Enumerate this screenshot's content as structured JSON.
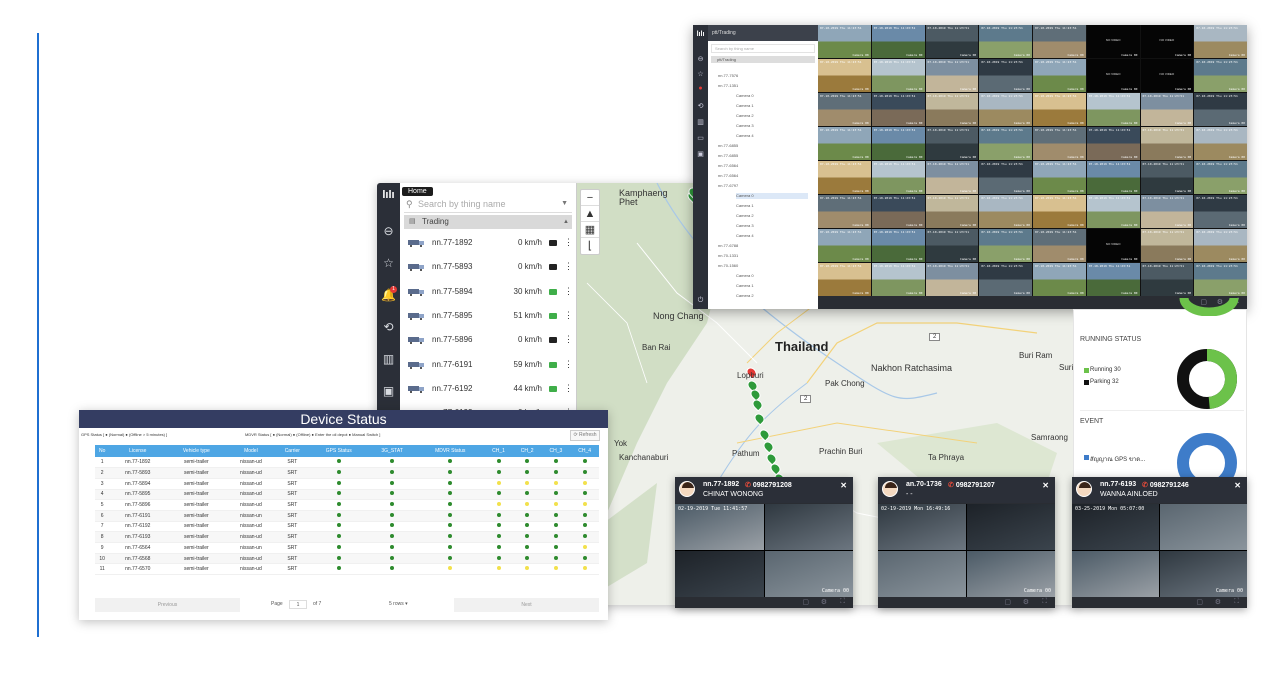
{
  "map": {
    "home_tooltip": "Home",
    "search_placeholder": "Search by thing name",
    "group_name": "Trading",
    "zoom_in": "+",
    "zoom_out": "−",
    "labels": {
      "country": "Thailand",
      "kamphaeng": "Kamphaeng\nPhet",
      "nong_chang": "Nong Chang",
      "ban_rai": "Ban Rai",
      "lopburi": "Lopburi",
      "pak_chong": "Pak Chong",
      "nakhon": "Nakhon Ratchasima",
      "buri_ram": "Buri Ram",
      "surin": "Surin",
      "kanchanaburi": "Kanchanaburi",
      "pathum": "Pathum",
      "prachin": "Prachin Buri",
      "ta_phraya": "Ta Phraya",
      "samraong": "Samraong",
      "yok": "Yok",
      "road_2": "2",
      "road_2b": "2"
    },
    "vehicles": [
      {
        "plate": "nn.77-1892",
        "speed": "0 km/h",
        "status_color": "#222222"
      },
      {
        "plate": "nn.77-5893",
        "speed": "0 km/h",
        "status_color": "#222222"
      },
      {
        "plate": "nn.77-5894",
        "speed": "30 km/h",
        "status_color": "#3fae49"
      },
      {
        "plate": "nn.77-5895",
        "speed": "51 km/h",
        "status_color": "#3fae49"
      },
      {
        "plate": "nn.77-5896",
        "speed": "0 km/h",
        "status_color": "#222222"
      },
      {
        "plate": "nn.77-6191",
        "speed": "59 km/h",
        "status_color": "#3fae49"
      },
      {
        "plate": "nn.77-6192",
        "speed": "44 km/h",
        "status_color": "#3fae49"
      },
      {
        "plate": "nn.77-6193",
        "speed": "0 km/h",
        "status_color": "#222222"
      }
    ]
  },
  "camera_window": {
    "tree_header": "ptt/Trading",
    "tree_search": "Search by thing name",
    "tree_root": "ptt/Trading",
    "tree_items": [
      "nn.77-7576",
      "nn.77-1351",
      "Camera 0",
      "Camera 1",
      "Camera 2",
      "Camera 3",
      "Camera 4",
      "nn.77-6855",
      "nn.77-6855",
      "nn.77-6564",
      "nn.77-6564",
      "nn.77-6797",
      "Camera 0",
      "Camera 1",
      "Camera 2",
      "Camera 3",
      "Camera 4",
      "nn.77-6788",
      "nn.70-1331",
      "nn.70-1560",
      "Camera 0",
      "Camera 1",
      "Camera 2"
    ],
    "timestamp": "07-10-2019 Thu 11:23:51",
    "camera_label": "Camera 00",
    "no_video": "NO VIDEO"
  },
  "dashboard": {
    "running_title": "RUNNING STATUS",
    "running_label": "Running 30",
    "parking_label": "Parking 32",
    "event_title": "EVENT",
    "event_label": "สัญญาณ GPS ขาด...",
    "colors": {
      "running": "#6cc24a",
      "parking": "#111111",
      "event": "#3e7cc9"
    }
  },
  "device_status": {
    "title": "Device Status",
    "gps_legend": "GPS Status [ ● (Normal) ● (Offline > 5 minutes) ]",
    "mdvr_legend": "MDVR Status [ ● (Normal) ● (Offline) ● Enter the oil depot ● Manual Switch ]",
    "refresh": "Refresh",
    "columns": [
      "No",
      "License",
      "Vehicle type",
      "Model",
      "Carrier",
      "GPS Status",
      "3G_STAT",
      "MDVR Status",
      "CH_1",
      "CH_2",
      "CH_3",
      "CH_4"
    ],
    "rows": [
      [
        "1",
        "nn.77-1892",
        "semi-trailer",
        "nissan-ud",
        "SRT",
        "g",
        "g",
        "g",
        "g",
        "g",
        "g",
        "g"
      ],
      [
        "2",
        "nn.77-5893",
        "semi-trailer",
        "nissan-ud",
        "SRT",
        "g",
        "g",
        "g",
        "g",
        "g",
        "g",
        "g"
      ],
      [
        "3",
        "nn.77-5894",
        "semi-trailer",
        "nissan-ud",
        "SRT",
        "g",
        "g",
        "g",
        "y",
        "y",
        "y",
        "y"
      ],
      [
        "4",
        "nn.77-5895",
        "semi-trailer",
        "nissan-ud",
        "SRT",
        "g",
        "g",
        "g",
        "g",
        "g",
        "g",
        "g"
      ],
      [
        "5",
        "nn.77-5896",
        "semi-trailer",
        "nissan-ud",
        "SRT",
        "g",
        "g",
        "g",
        "y",
        "y",
        "y",
        "y"
      ],
      [
        "6",
        "nn.77-6191",
        "semi-trailer",
        "nissan-un",
        "SRT",
        "g",
        "g",
        "g",
        "g",
        "g",
        "g",
        "g"
      ],
      [
        "7",
        "nn.77-6192",
        "semi-trailer",
        "nissan-ud",
        "SRT",
        "g",
        "g",
        "g",
        "g",
        "g",
        "g",
        "g"
      ],
      [
        "8",
        "nn.77-6193",
        "semi-trailer",
        "nissan-ud",
        "SRT",
        "g",
        "g",
        "g",
        "g",
        "g",
        "g",
        "g"
      ],
      [
        "9",
        "nn.77-6564",
        "semi-trailer",
        "nissan-un",
        "SRT",
        "g",
        "g",
        "g",
        "g",
        "g",
        "g",
        "y"
      ],
      [
        "10",
        "nn.77-6568",
        "semi-trailer",
        "nissan-ud",
        "SRT",
        "g",
        "g",
        "g",
        "g",
        "g",
        "g",
        "g"
      ],
      [
        "11",
        "nn.77-6570",
        "semi-trailer",
        "nissan-ud",
        "SRT",
        "g",
        "g",
        "y",
        "y",
        "y",
        "y",
        "y"
      ]
    ],
    "pager": {
      "previous": "Previous",
      "page_label": "Page",
      "page_value": "1",
      "of_label": "of 7",
      "rows_select": "5 rows",
      "next": "Next"
    }
  },
  "popups": [
    {
      "plate": "nn.77-1892",
      "phone": "0982791208",
      "driver": "CHINAT WONONG",
      "timestamp": "02-19-2019 Tue 11:41:57",
      "camera_label": "Camera 00"
    },
    {
      "plate": "an.70-1736",
      "phone": "0982791207",
      "driver": "- -",
      "timestamp": "02-19-2019 Mon 16:49:16",
      "camera_label": "Camera 00"
    },
    {
      "plate": "nn.77-6193",
      "phone": "0982791246",
      "driver": "WANNA AINLOED",
      "timestamp": "03-25-2019 Mon 05:07:00",
      "camera_label": "Camera 00"
    }
  ]
}
